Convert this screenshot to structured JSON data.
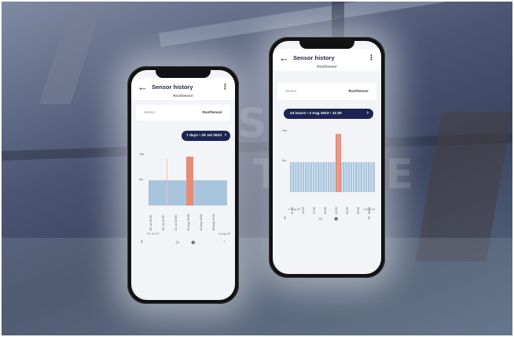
{
  "colors": {
    "header_dark": "#1a2340",
    "range_pill": "#1c2551",
    "bar_base": "#a9c5dd",
    "bar_highlight": "#ea8a72",
    "screen_bg": "#f3f4f8"
  },
  "watermark": {
    "line1": "SPEC",
    "line2": "TABLE"
  },
  "phone_left": {
    "header": {
      "back_icon": "←",
      "title": "Sensor history",
      "menu_icon": "⋮",
      "subtitle": "RoofSensor"
    },
    "sensor_row": {
      "label": "Sensor",
      "value": "RoofSensor"
    },
    "range": {
      "text": "7 days • 29 Jul 2023",
      "chevron": "›"
    },
    "chart": {
      "y_labels": [
        "Yes",
        "No"
      ],
      "x_labels": [
        "29 Jul 06:00",
        "30 Jul 21:00",
        "31 Jul 15:00",
        "02 Aug 09:00",
        "04 Aug 03:00",
        "05 Aug 21:00"
      ],
      "start_label": "29 Jul 23",
      "end_label": "6 Aug 23"
    },
    "nav": {
      "prev": "‹",
      "next": "›",
      "zoom_out": "⊖",
      "zoom_in": "⊕"
    }
  },
  "phone_right": {
    "header": {
      "back_icon": "←",
      "title": "Sensor history",
      "menu_icon": "⋮",
      "subtitle": "RoofSensor"
    },
    "sensor_row": {
      "label": "Sensor",
      "value": "RoofSensor"
    },
    "range": {
      "text": "24 hours • 2 Aug 2023 • 11:00",
      "chevron": "›"
    },
    "chart": {
      "y_labels": [
        "Yes",
        "No"
      ],
      "x_labels": [
        "11:00",
        "14:00",
        "17:00",
        "20:00",
        "23:00",
        "02:00",
        "05:00",
        "08:00"
      ],
      "start_label": "2 Aug 23",
      "end_label": "3 Aug 23"
    },
    "nav": {
      "prev": "‹",
      "next": "›",
      "zoom_out": "⊖",
      "zoom_in": "⊕"
    }
  },
  "chart_data": [
    {
      "type": "bar",
      "title": "",
      "categories": [
        "29 Jul 06:00",
        "30 Jul 21:00",
        "31 Jul 15:00",
        "02 Aug 09:00",
        "04 Aug 03:00",
        "05 Aug 21:00"
      ],
      "y_categories": [
        "No",
        "Yes"
      ],
      "series": [
        {
          "values": [
            0,
            0,
            0,
            1,
            0,
            0
          ]
        }
      ],
      "highlight_index": 3
    },
    {
      "type": "bar",
      "title": "",
      "categories": [
        "11:00",
        "14:00",
        "17:00",
        "20:00",
        "23:00",
        "02:00",
        "05:00",
        "08:00"
      ],
      "y_categories": [
        "No",
        "Yes"
      ],
      "series": [
        {
          "values": [
            0,
            0,
            0,
            0,
            1,
            0,
            0,
            0
          ]
        }
      ],
      "highlight_index": 4
    }
  ]
}
